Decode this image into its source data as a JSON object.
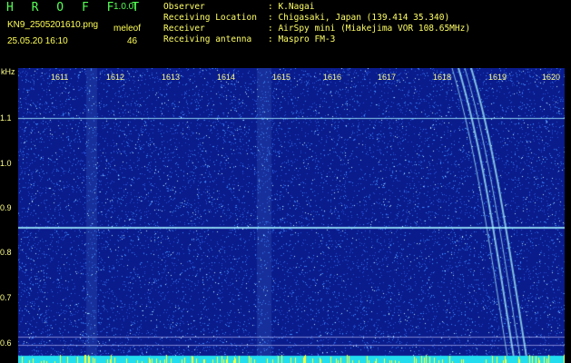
{
  "header": {
    "brand": "H R O F F T",
    "version": "1.0.0f",
    "filename": "KN9_2505201610.png",
    "mode": "meleof",
    "datetime": "25.05.20 16:10",
    "count": "46"
  },
  "station_info": [
    {
      "label": "Observer",
      "value": ": K.Nagai"
    },
    {
      "label": "Receiving Location",
      "value": ": Chigasaki, Japan (139.414 35.340)"
    },
    {
      "label": "Receiver",
      "value": ": AirSpy mini (Miakejima VOR 108.65MHz)"
    },
    {
      "label": "Receiving antenna",
      "value": ": Maspro FM-3"
    }
  ],
  "axes": {
    "y_unit": "kHz",
    "y_ticks": [
      "1.1",
      "1.0",
      "0.9",
      "0.8",
      "0.7",
      "0.6"
    ],
    "x_ticks": [
      "1611",
      "1612",
      "1613",
      "1614",
      "1615",
      "1616",
      "1617",
      "1618",
      "1619",
      "1620"
    ]
  },
  "colors": {
    "background": "#0a1b8c",
    "noise": "#4aa8ff",
    "signal": "#9ff7ff",
    "text_yellow": "#ffff66",
    "text_green": "#55ff55"
  }
}
